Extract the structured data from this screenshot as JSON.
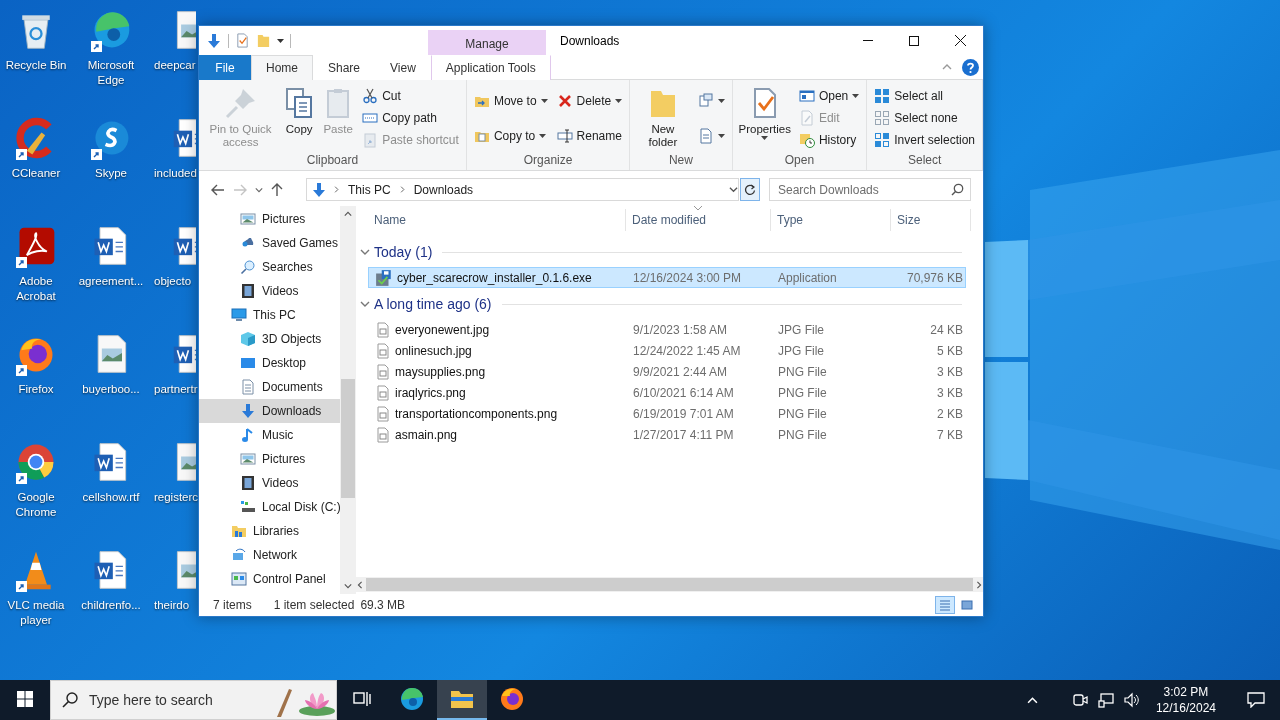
{
  "desktop": {
    "icons": [
      {
        "label": "Recycle Bin",
        "kind": "recycle",
        "shortcut": false
      },
      {
        "label": "Microsoft Edge",
        "kind": "edge",
        "shortcut": true
      },
      {
        "label": "deepcar",
        "kind": "image",
        "shortcut": false
      },
      {
        "label": "CCleaner",
        "kind": "ccleaner",
        "shortcut": true
      },
      {
        "label": "Skype",
        "kind": "skype",
        "shortcut": true
      },
      {
        "label": "included",
        "kind": "word",
        "shortcut": false
      },
      {
        "label": "Adobe Acrobat",
        "kind": "acrobat",
        "shortcut": true
      },
      {
        "label": "agreement...",
        "kind": "word",
        "shortcut": false
      },
      {
        "label": "objecto",
        "kind": "word",
        "shortcut": false
      },
      {
        "label": "Firefox",
        "kind": "firefox",
        "shortcut": true
      },
      {
        "label": "buyerboo...",
        "kind": "image",
        "shortcut": false
      },
      {
        "label": "partnertr",
        "kind": "word",
        "shortcut": false
      },
      {
        "label": "Google Chrome",
        "kind": "chrome",
        "shortcut": true
      },
      {
        "label": "cellshow.rtf",
        "kind": "word",
        "shortcut": false
      },
      {
        "label": "registerc",
        "kind": "image",
        "shortcut": false
      },
      {
        "label": "VLC media player",
        "kind": "vlc",
        "shortcut": true
      },
      {
        "label": "childrenfo...",
        "kind": "word",
        "shortcut": false
      },
      {
        "label": "theirdo",
        "kind": "image",
        "shortcut": false
      }
    ]
  },
  "window": {
    "context_header": "Manage",
    "title": "Downloads",
    "tabs": [
      {
        "label": "File",
        "kind": "file",
        "selected": false
      },
      {
        "label": "Home",
        "kind": "normal",
        "selected": true
      },
      {
        "label": "Share",
        "kind": "normal",
        "selected": false
      },
      {
        "label": "View",
        "kind": "normal",
        "selected": false
      },
      {
        "label": "Application Tools",
        "kind": "context",
        "selected": false
      }
    ],
    "ribbon": {
      "groups": [
        {
          "label": "Clipboard",
          "columns": [
            {
              "kind": "large",
              "items": [
                {
                  "label": "Pin to Quick access",
                  "kind": "pin",
                  "disabled": true
                }
              ]
            },
            {
              "kind": "large",
              "items": [
                {
                  "label": "Copy",
                  "kind": "copy",
                  "disabled": false
                }
              ]
            },
            {
              "kind": "large",
              "items": [
                {
                  "label": "Paste",
                  "kind": "paste",
                  "disabled": true
                }
              ]
            },
            {
              "kind": "small",
              "items": [
                {
                  "label": "Cut",
                  "kind": "cut",
                  "disabled": false
                },
                {
                  "label": "Copy path",
                  "kind": "copypath",
                  "disabled": false
                },
                {
                  "label": "Paste shortcut",
                  "kind": "pasteshortcut",
                  "disabled": true
                }
              ]
            }
          ]
        },
        {
          "label": "Organize",
          "columns": [
            {
              "kind": "small",
              "items": [
                {
                  "label": "Move to",
                  "kind": "move",
                  "disabled": false,
                  "dropdown": true
                },
                {
                  "label": "Copy to",
                  "kind": "copyto",
                  "disabled": false,
                  "dropdown": true
                }
              ]
            },
            {
              "kind": "small",
              "items": [
                {
                  "label": "Delete",
                  "kind": "delete",
                  "disabled": false,
                  "dropdown": true
                },
                {
                  "label": "Rename",
                  "kind": "rename",
                  "disabled": false
                }
              ]
            }
          ]
        },
        {
          "label": "New",
          "columns": [
            {
              "kind": "large",
              "items": [
                {
                  "label": "New folder",
                  "kind": "folder",
                  "disabled": false
                }
              ]
            },
            {
              "kind": "small",
              "items": [
                {
                  "kind": "newitem",
                  "disabled": false,
                  "dropdown": true
                },
                {
                  "kind": "easyaccess",
                  "disabled": false,
                  "dropdown": true
                }
              ]
            }
          ]
        },
        {
          "label": "Open",
          "columns": [
            {
              "kind": "large",
              "items": [
                {
                  "label": "Properties",
                  "kind": "properties",
                  "disabled": false,
                  "dropdown": true
                }
              ]
            },
            {
              "kind": "small",
              "items": [
                {
                  "label": "Open",
                  "kind": "open",
                  "disabled": false,
                  "dropdown": true
                },
                {
                  "label": "Edit",
                  "kind": "edit",
                  "disabled": true
                },
                {
                  "label": "History",
                  "kind": "history",
                  "disabled": false
                }
              ]
            }
          ]
        },
        {
          "label": "Select",
          "columns": [
            {
              "kind": "small",
              "items": [
                {
                  "label": "Select all",
                  "kind": "selectall",
                  "disabled": false
                },
                {
                  "label": "Select none",
                  "kind": "selectnone",
                  "disabled": false
                },
                {
                  "label": "Invert selection",
                  "kind": "invert",
                  "disabled": false
                }
              ]
            }
          ]
        }
      ]
    },
    "address": {
      "segments": [
        "This PC",
        "Downloads"
      ]
    },
    "search": {
      "placeholder": "Search Downloads"
    },
    "nav_pane": {
      "items": [
        {
          "children": [
            {
              "label": "Pictures",
              "kind": "pictures",
              "selected": false
            },
            {
              "label": "Saved Games",
              "kind": "games",
              "selected": false
            },
            {
              "label": "Searches",
              "kind": "search",
              "selected": false
            },
            {
              "label": "Videos",
              "kind": "videos",
              "selected": false
            }
          ]
        },
        {
          "label": "This PC",
          "kind": "pc",
          "selected": false,
          "children": [
            {
              "label": "3D Objects",
              "kind": "objects",
              "selected": false
            },
            {
              "label": "Desktop",
              "kind": "desktop",
              "selected": false
            },
            {
              "label": "Documents",
              "kind": "documents",
              "selected": false
            },
            {
              "label": "Downloads",
              "kind": "downloads",
              "selected": true
            },
            {
              "label": "Music",
              "kind": "music",
              "selected": false
            },
            {
              "label": "Pictures",
              "kind": "pictures",
              "selected": false
            },
            {
              "label": "Videos",
              "kind": "videos",
              "selected": false
            },
            {
              "label": "Local Disk (C:)",
              "kind": "disk",
              "selected": false
            }
          ]
        },
        {
          "label": "Libraries",
          "kind": "libraries",
          "selected": false
        },
        {
          "label": "Network",
          "kind": "network",
          "selected": false
        },
        {
          "label": "Control Panel",
          "kind": "control",
          "selected": false
        }
      ]
    },
    "columns": [
      {
        "label": "Name",
        "sorted": false
      },
      {
        "label": "Date modified",
        "sorted": true
      },
      {
        "label": "Type",
        "sorted": false
      },
      {
        "label": "Size",
        "sorted": false
      }
    ],
    "groups": [
      {
        "label": "Today (1)",
        "expanded": true,
        "rows": [
          {
            "name": "cyber_scarecrow_installer_0.1.6.exe",
            "kind": "exe",
            "date": "12/16/2024 3:00 PM",
            "type": "Application",
            "size": "70,976 KB",
            "selected": true
          }
        ]
      },
      {
        "label": "A long time ago (6)",
        "expanded": true,
        "rows": [
          {
            "name": "everyonewent.jpg",
            "kind": "image",
            "date": "9/1/2023 1:58 AM",
            "type": "JPG File",
            "size": "24 KB",
            "selected": false
          },
          {
            "name": "onlinesuch.jpg",
            "kind": "image",
            "date": "12/24/2022 1:45 AM",
            "type": "JPG File",
            "size": "5 KB",
            "selected": false
          },
          {
            "name": "maysupplies.png",
            "kind": "image",
            "date": "9/9/2021 2:44 AM",
            "type": "PNG File",
            "size": "3 KB",
            "selected": false
          },
          {
            "name": "iraqlyrics.png",
            "kind": "image",
            "date": "6/10/2021 6:14 AM",
            "type": "PNG File",
            "size": "3 KB",
            "selected": false
          },
          {
            "name": "transportationcomponents.png",
            "kind": "image",
            "date": "6/19/2019 7:01 AM",
            "type": "PNG File",
            "size": "2 KB",
            "selected": false
          },
          {
            "name": "asmain.png",
            "kind": "image",
            "date": "1/27/2017 4:11 PM",
            "type": "PNG File",
            "size": "7 KB",
            "selected": false
          }
        ]
      }
    ],
    "status": {
      "item_count": "7 items",
      "selection": "1 item selected",
      "size": "69.3 MB"
    },
    "views": [
      {
        "kind": "details",
        "selected": true
      },
      {
        "kind": "large_icons",
        "selected": false
      }
    ]
  },
  "taskbar": {
    "search_placeholder": "Type here to search",
    "apps": [
      {
        "kind": "taskview",
        "active": false
      },
      {
        "kind": "edge",
        "active": false
      },
      {
        "kind": "explorer",
        "active": true
      },
      {
        "kind": "firefox",
        "active": false
      }
    ],
    "time": "3:02 PM",
    "date": "12/16/2024"
  }
}
